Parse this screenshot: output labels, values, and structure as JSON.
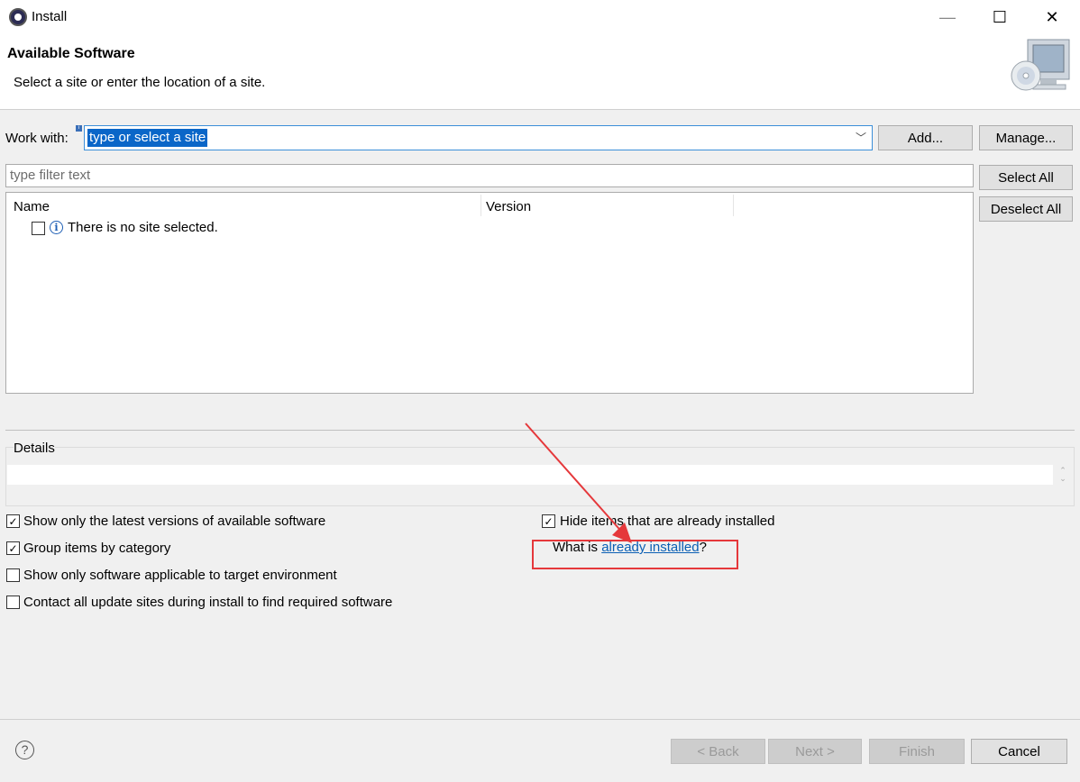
{
  "window": {
    "title": "Install",
    "minimize": "—",
    "maximize": "☐",
    "close": "✕"
  },
  "banner": {
    "title": "Available Software",
    "description": "Select a site or enter the location of a site."
  },
  "work_with": {
    "label": "Work with:",
    "value": "type or select a site",
    "add_label": "Add...",
    "manage_label": "Manage..."
  },
  "filter": {
    "placeholder": "type filter text"
  },
  "selection": {
    "select_all_label": "Select All",
    "deselect_all_label": "Deselect All"
  },
  "table": {
    "columns": [
      "Name",
      "Version"
    ],
    "rows": [
      {
        "checked": false,
        "text": "There is no site selected."
      }
    ]
  },
  "details": {
    "label": "Details",
    "value": ""
  },
  "options": [
    {
      "label": "Show only the latest versions of available software",
      "checked": true
    },
    {
      "label": "Group items by category",
      "checked": true
    },
    {
      "label": "Show only software applicable to target environment",
      "checked": false
    },
    {
      "label": "Contact all update sites during install to find required software",
      "checked": false
    },
    {
      "label": "Hide items that are already installed",
      "checked": true
    }
  ],
  "installed_link": {
    "prefix": "What is ",
    "link": "already installed",
    "suffix": "?"
  },
  "footer": {
    "back_label": "< Back",
    "next_label": "Next >",
    "finish_label": "Finish",
    "cancel_label": "Cancel"
  },
  "colors": {
    "link": "#0b5fb4",
    "selection": "#0a66c8",
    "annotation": "#e5383b"
  }
}
